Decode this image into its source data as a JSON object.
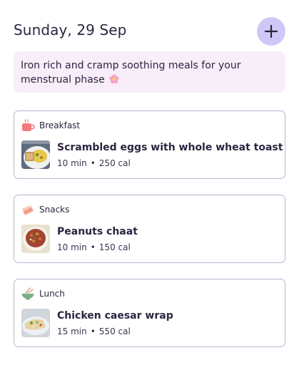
{
  "header": {
    "date": "Sunday, 29 Sep",
    "add_icon": "plus-icon"
  },
  "banner": {
    "text": "Iron rich and cramp soothing meals for your menstrual phase",
    "emoji_icon": "flower-icon"
  },
  "meals": [
    {
      "type": "Breakfast",
      "type_icon": "mug-icon",
      "dish": "Scrambled eggs with whole wheat toast",
      "time": "10 min",
      "calories": "250 cal"
    },
    {
      "type": "Snacks",
      "type_icon": "cake-slice-icon",
      "dish": "Peanuts chaat",
      "time": "10 min",
      "calories": "150 cal"
    },
    {
      "type": "Lunch",
      "type_icon": "bowl-icon",
      "dish": "Chicken caesar wrap",
      "time": "15 min",
      "calories": "550 cal"
    }
  ],
  "colors": {
    "accent": "#cfc8f7",
    "banner_bg": "#f7eef9",
    "card_border": "#b9b4d2",
    "text": "#2b2540"
  }
}
